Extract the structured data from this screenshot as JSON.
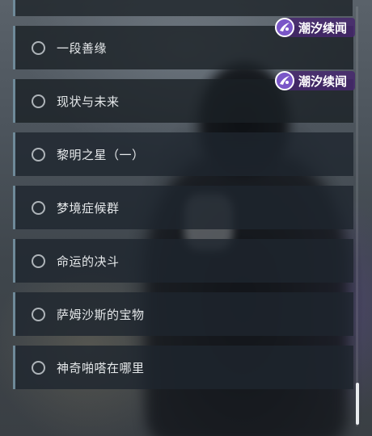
{
  "watermarks": [
    {
      "text": "潮汐续闻",
      "icon": "tide-logo-icon"
    },
    {
      "text": "潮汐续闻",
      "icon": "tide-logo-icon"
    }
  ],
  "quests": [
    {
      "label": "一段善缘",
      "status_icon": "incomplete-circle-icon"
    },
    {
      "label": "现状与未来",
      "status_icon": "incomplete-circle-icon"
    },
    {
      "label": "黎明之星（一）",
      "status_icon": "incomplete-circle-icon"
    },
    {
      "label": "梦境症候群",
      "status_icon": "incomplete-circle-icon"
    },
    {
      "label": "命运的决斗",
      "status_icon": "incomplete-circle-icon"
    },
    {
      "label": "萨姆沙斯的宝物",
      "status_icon": "incomplete-circle-icon"
    },
    {
      "label": "神奇啪嗒在哪里",
      "status_icon": "incomplete-circle-icon"
    }
  ],
  "colors": {
    "accent_bar": "#6f8a99",
    "watermark_bg": "#46286e",
    "watermark_icon": "#7a56c8",
    "text": "#e6e9eb"
  }
}
